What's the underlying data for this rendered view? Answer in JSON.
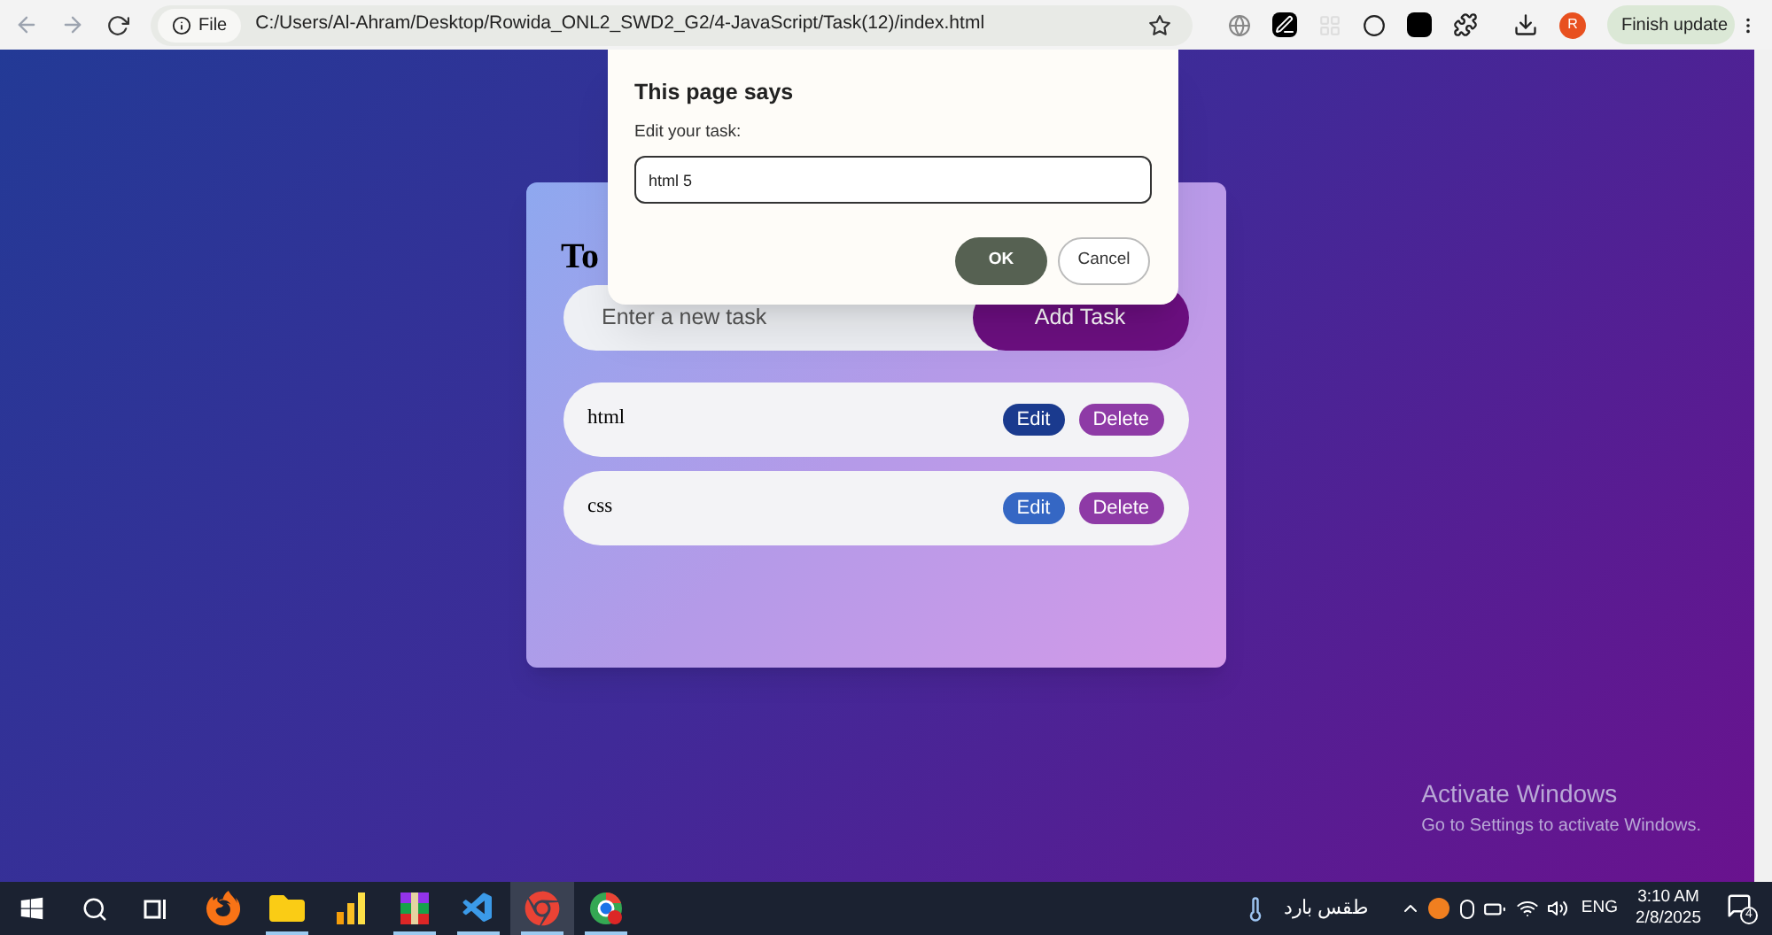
{
  "browser": {
    "address": {
      "scheme_label": "File",
      "url": "C:/Users/Al-Ahram/Desktop/Rowida_ONL2_SWD2_G2/4-JavaScript/Task(12)/index.html"
    },
    "profile_initial": "R",
    "update_button": "Finish update"
  },
  "page": {
    "title": "To",
    "task_input": {
      "placeholder": "Enter a new task"
    },
    "add_button": "Add Task",
    "tasks": [
      {
        "text": "html",
        "edit_label": "Edit",
        "delete_label": "Delete",
        "edit_hovered": true
      },
      {
        "text": "css",
        "edit_label": "Edit",
        "delete_label": "Delete",
        "edit_hovered": false
      }
    ]
  },
  "dialog": {
    "title": "This page says",
    "message": "Edit your task:",
    "value": "html 5",
    "ok": "OK",
    "cancel": "Cancel"
  },
  "activation": {
    "title": "Activate Windows",
    "subtitle": "Go to Settings to activate Windows."
  },
  "taskbar": {
    "apps": [
      {
        "kind": "firefox",
        "open": false,
        "selected": false
      },
      {
        "kind": "folder",
        "open": true,
        "selected": false
      },
      {
        "kind": "chart",
        "open": false,
        "selected": false
      },
      {
        "kind": "archive",
        "open": true,
        "selected": false
      },
      {
        "kind": "code",
        "open": true,
        "selected": false
      },
      {
        "kind": "chrome",
        "open": true,
        "selected": true
      },
      {
        "kind": "chrome-profile",
        "open": true,
        "selected": false
      }
    ],
    "weather": "طقس بارد",
    "language": "ENG",
    "time": "3:10 AM",
    "date": "2/8/2025",
    "notifications": "4"
  }
}
